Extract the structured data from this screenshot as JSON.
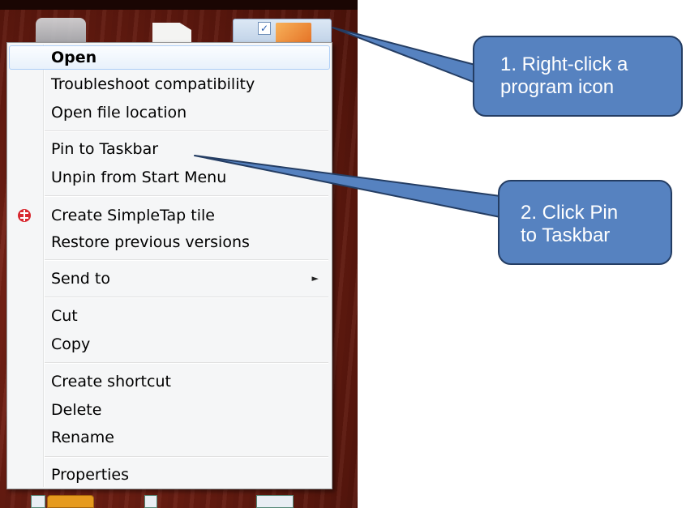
{
  "menu": {
    "items": [
      {
        "label": "Open",
        "bold": true,
        "highlighted": true
      },
      {
        "label": "Troubleshoot compatibility"
      },
      {
        "label": "Open file location"
      },
      {
        "label": "Pin to Taskbar"
      },
      {
        "label": "Unpin from Start Menu"
      },
      {
        "label": "Create SimpleTap tile",
        "icon": "simpletap-icon"
      },
      {
        "label": "Restore previous versions"
      },
      {
        "label": "Send to",
        "submenu": true
      },
      {
        "label": "Cut"
      },
      {
        "label": "Copy"
      },
      {
        "label": "Create shortcut"
      },
      {
        "label": "Delete"
      },
      {
        "label": "Rename"
      },
      {
        "label": "Properties"
      }
    ]
  },
  "callouts": {
    "step1": {
      "line1": "1. Right-click a",
      "line2": "program icon"
    },
    "step2": {
      "line1": "2. Click Pin",
      "line2": "to Taskbar"
    }
  },
  "colors": {
    "callout_fill": "#5682c0",
    "callout_border": "#243d63",
    "menu_background": "#f5f6f7",
    "desktop_background": "#6b1d12"
  }
}
